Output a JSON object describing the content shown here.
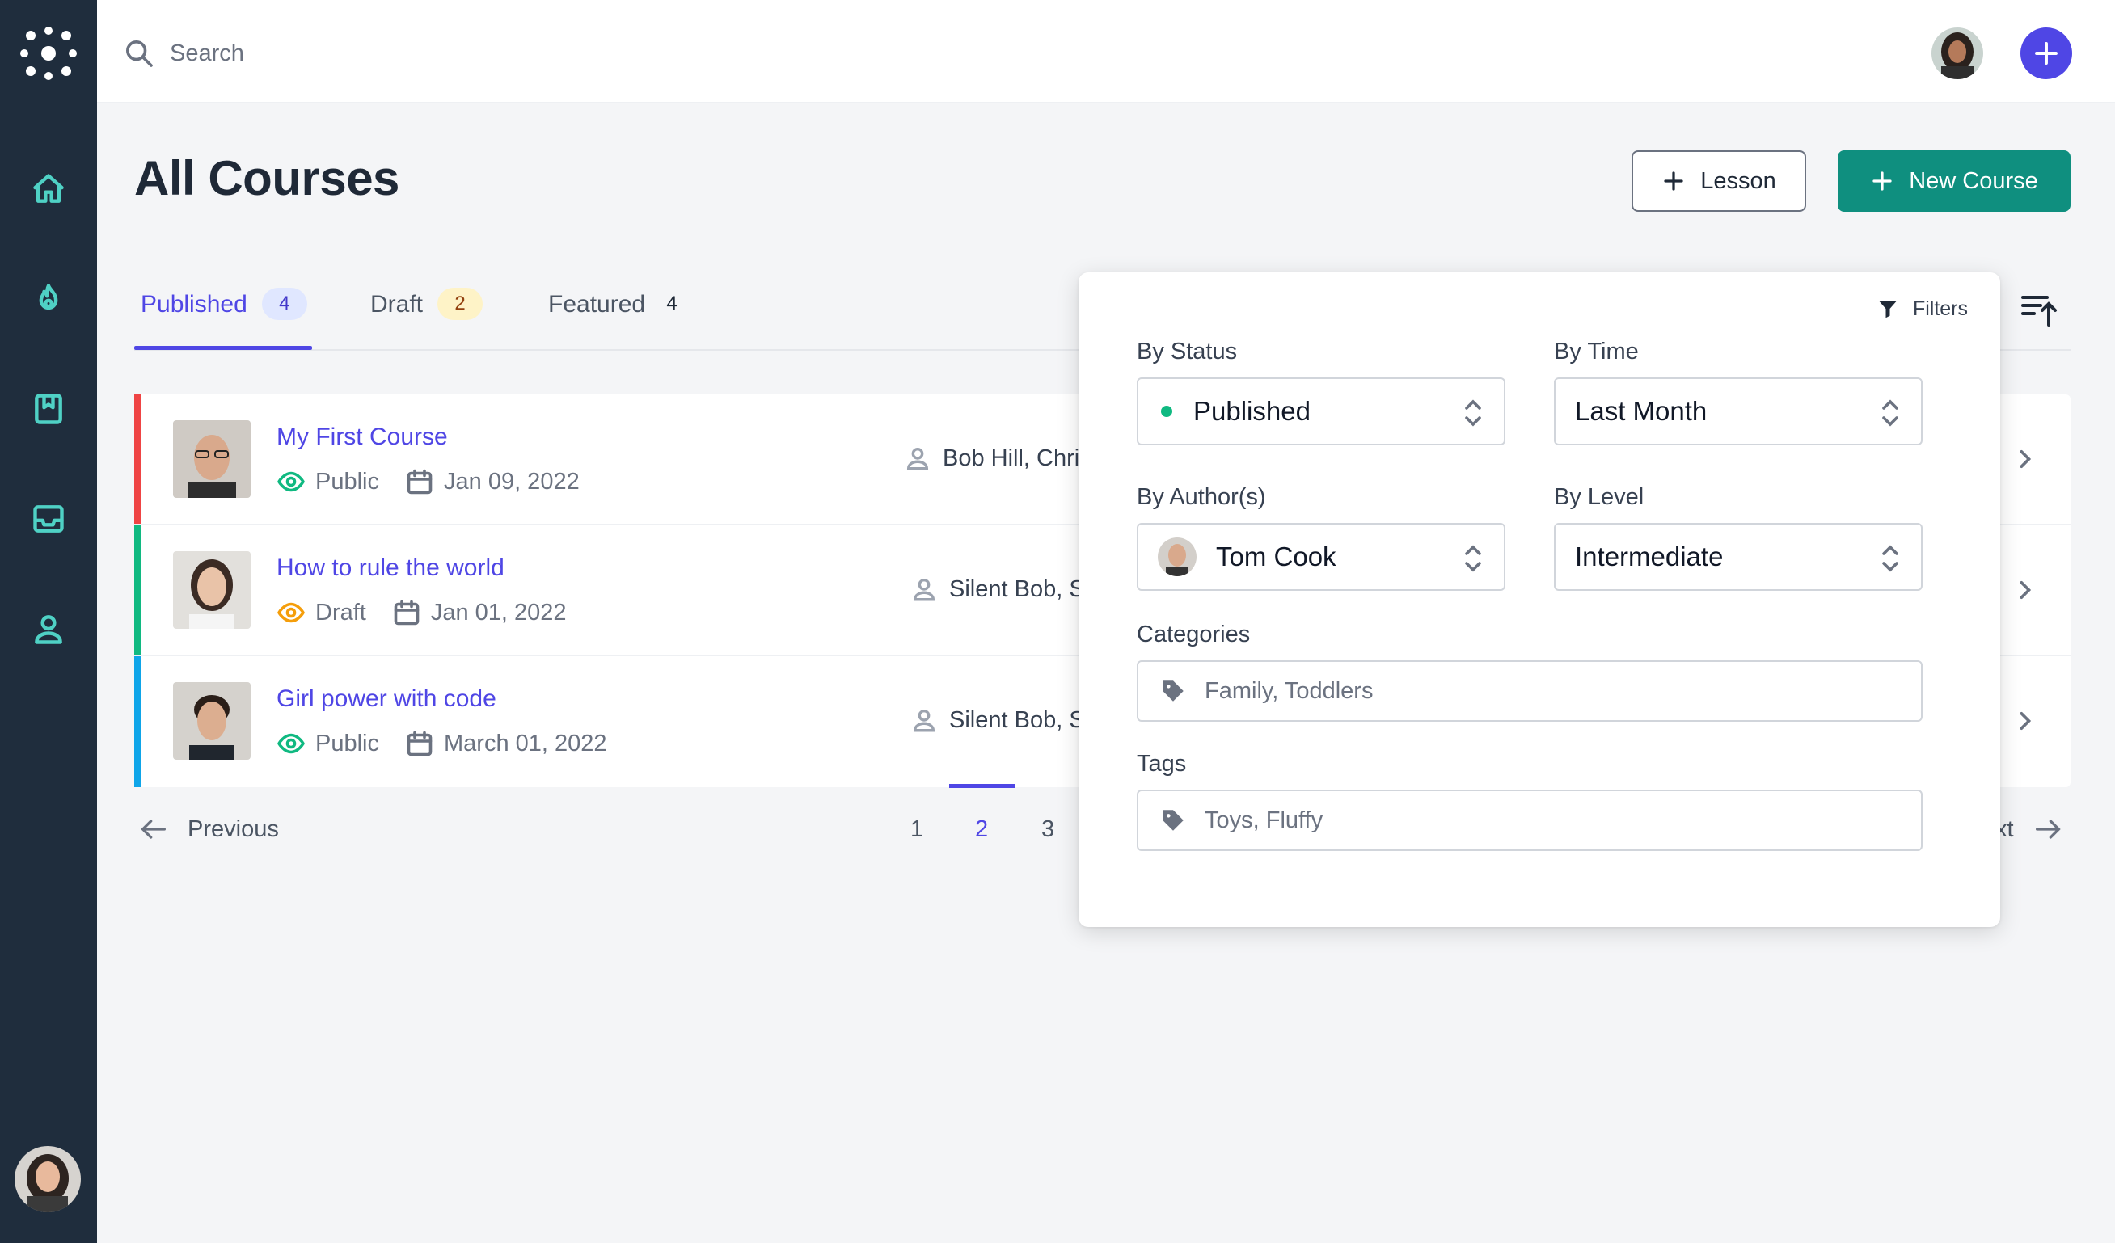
{
  "topbar": {
    "search_placeholder": "Search"
  },
  "header": {
    "title": "All Courses",
    "lesson_button": "Lesson",
    "new_course_button": "New Course"
  },
  "tabs": [
    {
      "label": "Published",
      "count": "4",
      "active": true
    },
    {
      "label": "Draft",
      "count": "2",
      "active": false
    },
    {
      "label": "Featured",
      "count": "4",
      "active": false
    }
  ],
  "courses": [
    {
      "title": "My First Course",
      "visibility": "Public",
      "date": "Jan 09, 2022",
      "authors": "Bob Hill, Chri",
      "stripe_color": "#ef4444",
      "visibility_color": "#10b981"
    },
    {
      "title": "How to rule the world",
      "visibility": "Draft",
      "date": "Jan 01, 2022",
      "authors": "Silent Bob, S",
      "stripe_color": "#10b981",
      "visibility_color": "#f59e0b"
    },
    {
      "title": "Girl power with code",
      "visibility": "Public",
      "date": "March 01, 2022",
      "authors": "Silent Bob, S",
      "stripe_color": "#0ea5e9",
      "visibility_color": "#10b981"
    }
  ],
  "pagination": {
    "previous": "Previous",
    "pages": [
      "1",
      "2",
      "3"
    ],
    "current": "2",
    "next_partial": "xt"
  },
  "filters": {
    "heading": "Filters",
    "status_label": "By Status",
    "status_value": "Published",
    "time_label": "By Time",
    "time_value": "Last Month",
    "author_label": "By Author(s)",
    "author_value": "Tom Cook",
    "level_label": "By Level",
    "level_value": "Intermediate",
    "categories_label": "Categories",
    "categories_value": "Family, Toddlers",
    "tags_label": "Tags",
    "tags_value": "Toys, Fluffy"
  },
  "icons": {
    "sidebar": [
      "home-icon",
      "fire-icon",
      "bookmark-book-icon",
      "inbox-icon",
      "user-icon"
    ],
    "accent": "#4f46e5",
    "brand_green": "#0f8f7f",
    "sidebar_bg": "#1f2d3d"
  }
}
